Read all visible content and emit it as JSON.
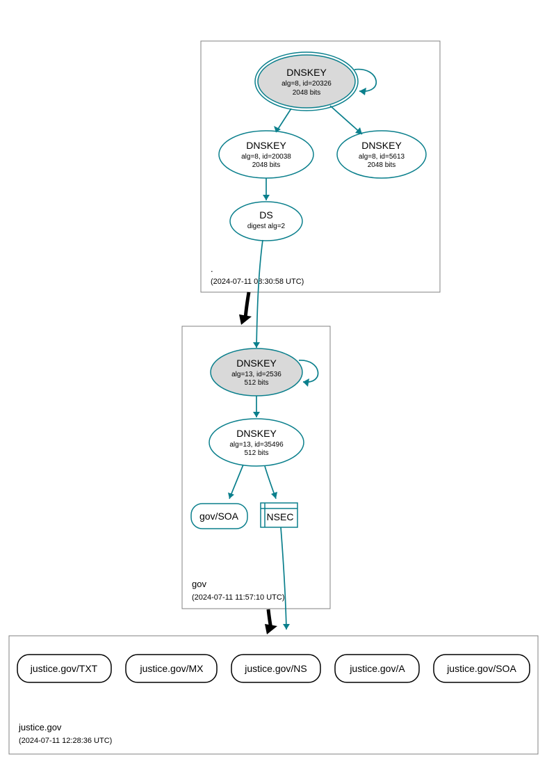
{
  "colors": {
    "teal": "#0a7f8c",
    "gray": "#d9d9d9"
  },
  "zones": {
    "root": {
      "name": ".",
      "timestamp": "(2024-07-11 08:30:58 UTC)"
    },
    "gov": {
      "name": "gov",
      "timestamp": "(2024-07-11 11:57:10 UTC)"
    },
    "justice": {
      "name": "justice.gov",
      "timestamp": "(2024-07-11 12:28:36 UTC)"
    }
  },
  "nodes": {
    "root_ksk": {
      "title": "DNSKEY",
      "sub1": "alg=8, id=20326",
      "sub2": "2048 bits"
    },
    "root_zsk": {
      "title": "DNSKEY",
      "sub1": "alg=8, id=20038",
      "sub2": "2048 bits"
    },
    "root_other": {
      "title": "DNSKEY",
      "sub1": "alg=8, id=5613",
      "sub2": "2048 bits"
    },
    "root_ds": {
      "title": "DS",
      "sub1": "digest alg=2"
    },
    "gov_ksk": {
      "title": "DNSKEY",
      "sub1": "alg=13, id=2536",
      "sub2": "512 bits"
    },
    "gov_zsk": {
      "title": "DNSKEY",
      "sub1": "alg=13, id=35496",
      "sub2": "512 bits"
    },
    "gov_soa": {
      "title": "gov/SOA"
    },
    "gov_nsec": {
      "title": "NSEC"
    },
    "leaves": {
      "txt": "justice.gov/TXT",
      "mx": "justice.gov/MX",
      "ns": "justice.gov/NS",
      "a": "justice.gov/A",
      "soa": "justice.gov/SOA"
    }
  }
}
